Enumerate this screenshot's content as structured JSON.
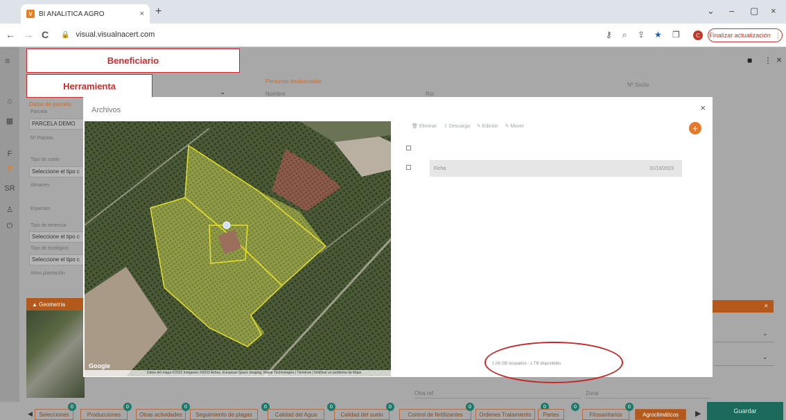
{
  "browser": {
    "tab_title": "BI ANALITICA AGRO",
    "tab_favicon": "V",
    "tab_close": "×",
    "new_tab": "+",
    "url": "visual.visualnacert.com",
    "profile_initial": "C",
    "update_button": "Finalizar actualización",
    "update_menu": "⋮",
    "window_controls": [
      "⌄",
      "–",
      "▢",
      "×"
    ]
  },
  "icons": {
    "back": "←",
    "forward": "→",
    "reload": "C",
    "lock": "🔒",
    "key": "⚷",
    "zoom": "⌕",
    "share": "⇪",
    "star": "★",
    "sidebar": "❐"
  },
  "app": {
    "rail": [
      {
        "icon": "home-icon",
        "glyph": "⌂"
      },
      {
        "icon": "dashboard-icon",
        "glyph": "▦"
      },
      {
        "label": "F"
      },
      {
        "label": "P"
      },
      {
        "label": "SR"
      },
      {
        "icon": "user-icon",
        "glyph": "♙"
      },
      {
        "icon": "power-icon",
        "glyph": "⏻"
      }
    ],
    "menu_glyph": "≡",
    "top_right": {
      "folder": "■",
      "more": "⋮",
      "close": "×"
    }
  },
  "callouts": {
    "beneficiario": "Beneficiario",
    "herramienta": "Herramienta"
  },
  "background_form": {
    "personas_header": "Personas involucradas",
    "col_nombre": "Nombre",
    "col_rol": "Rol",
    "n_socio": "Nº Socio",
    "datos_parcela": "Datos de parcela",
    "parcela_label": "Parcela",
    "parcela_value": "PARCELA DEMO",
    "n_plantas": "Nº Plantas",
    "tipo_suelo": "Tipo de suelo",
    "tipo_suelo_value": "Seleccione el tipo c",
    "almacen": "Almacén",
    "especies": "Especies",
    "tipo_tenencia": "Tipo de tenencia",
    "tipo_tenencia_value": "Seleccione el tipo c",
    "tipo_ecologico": "Tipo de ecológico",
    "tipo_ecologico_value": "Seleccione el tipo c",
    "anos_plantacion": "Años plantación",
    "geometria": "▲ Geometría",
    "otra_ref": "Otra ref",
    "zona": "Zona",
    "chevron": "⌄",
    "orange_close": "×"
  },
  "modal": {
    "title": "Archivos",
    "close": "×",
    "actions": [
      "🗑 Eliminar",
      "⇩ Descarga",
      "✎ Edición",
      "✎ Mover"
    ],
    "add": "+",
    "file_name": "Ficha",
    "file_date": "31/10/2023",
    "storage": "1.06 GB ocupados - 1 TB disponibles",
    "map_footer": "Datos del mapa ©2023 Imágenes ©2023 Airbus, European Space Imaging, Maxar Technologies | Términos | Notificar un problema de Maps",
    "map_brand": "Google"
  },
  "bottom_tabs": [
    {
      "label": "Selecciones",
      "badge": "0"
    },
    {
      "label": "Producciones",
      "badge": "0"
    },
    {
      "label": "Otras actividades",
      "badge": "0"
    },
    {
      "label": "Seguimiento de plagas",
      "badge": "0"
    },
    {
      "label": "Calidad del Agua",
      "badge": "0"
    },
    {
      "label": "Calidad del suelo",
      "badge": "0"
    },
    {
      "label": "Control de fertilizantes",
      "badge": "0"
    },
    {
      "label": "Ordenes Tratamiento",
      "badge": "0"
    },
    {
      "label": "Partes",
      "badge": "0"
    },
    {
      "label": "Fitosanitarios",
      "badge": "0"
    },
    {
      "label": "Agroclimáticos",
      "badge": ""
    }
  ],
  "bottom_nav": {
    "left": "◀",
    "right": "▶"
  },
  "save_button": "Guardar"
}
